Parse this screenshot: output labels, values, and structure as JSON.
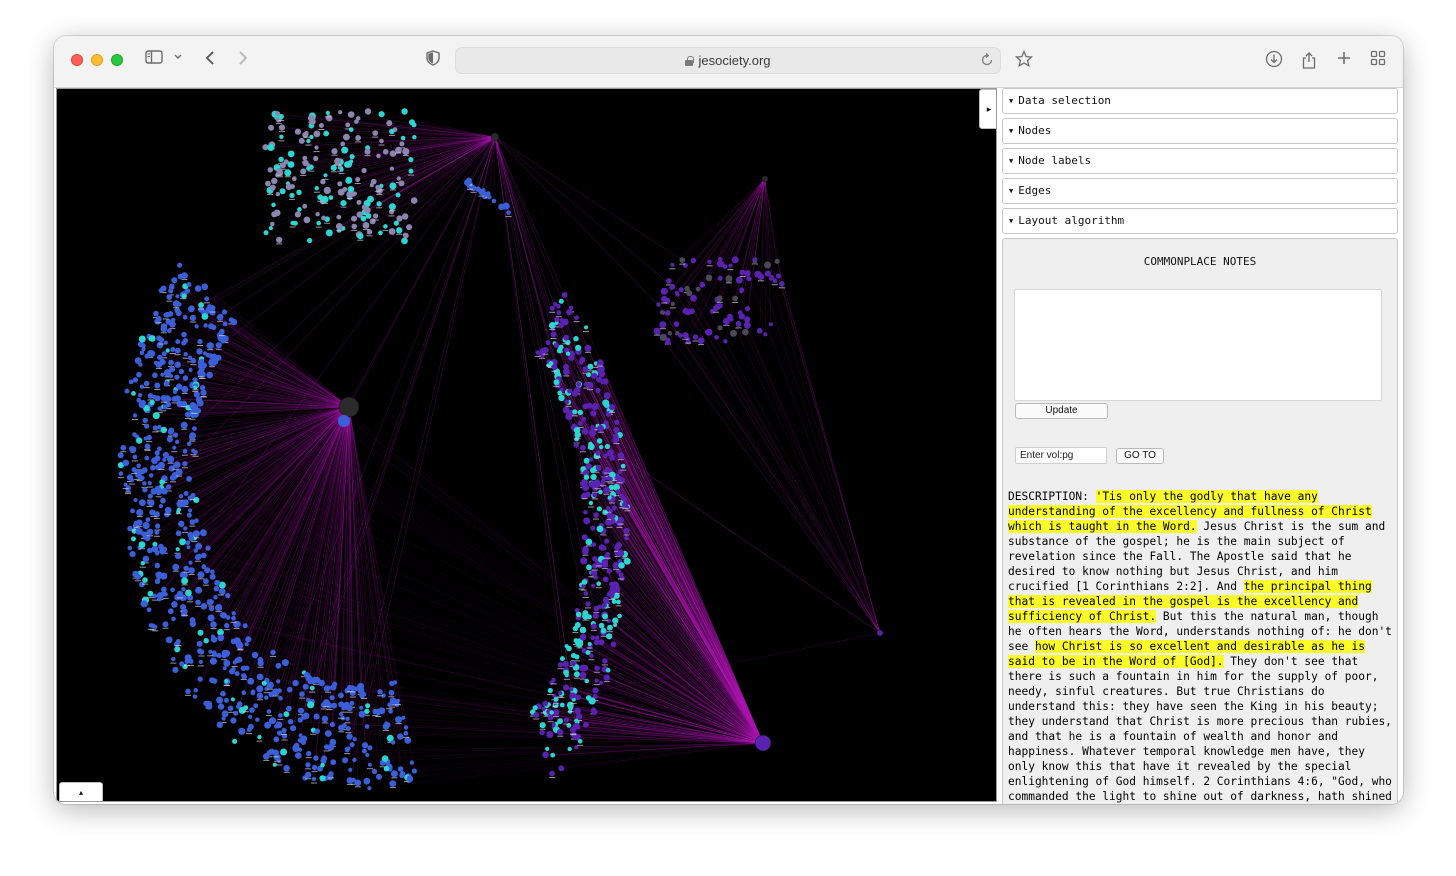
{
  "browser": {
    "url": "jesociety.org",
    "icons": [
      "sidebar-icon",
      "chevron-down-icon",
      "back-icon",
      "forward-icon",
      "shield-icon",
      "lock-icon",
      "reload-icon",
      "star-icon",
      "download-icon",
      "share-icon",
      "new-tab-icon",
      "tab-overview-icon"
    ]
  },
  "graph": {
    "toggle_right_label": "▸",
    "toggle_up_label": "▴",
    "colors": {
      "background": "#000000",
      "edge": "#b01cb8",
      "node_blue": "#3a5fd8",
      "node_cyan": "#2ad6d2",
      "node_purple": "#5a22b0",
      "hub": "#2a2a2a"
    }
  },
  "panel": {
    "sections": [
      {
        "label": "Data selection"
      },
      {
        "label": "Nodes"
      },
      {
        "label": "Node labels"
      },
      {
        "label": "Edges"
      },
      {
        "label": "Layout algorithm"
      }
    ],
    "notes": {
      "title": "COMMONPLACE NOTES",
      "update_label": "Update",
      "volpg_placeholder": "Enter vol:pg",
      "goto_label": "GO TO",
      "description_label": "DESCRIPTION:",
      "d1": "'Tis only the godly that have any understanding of the excellency and fullness of Christ which is taught in the Word.",
      "d2": " Jesus Christ is the sum and substance of the gospel; he is the main subject of revelation since the Fall. The Apostle said that he desired to know nothing but Jesus Christ, and him crucified [1 Corinthians 2:2]. And ",
      "d3": "the principal thing that is revealed in the gospel is the excellency and sufficiency of Christ.",
      "d4": " But this the natural man, though he often hears the Word, understands nothing of: he don't see ",
      "d5": "how Christ is so excellent and desirable as he is said to be in the Word of [God].",
      "d6": " They don't see that there is such a fountain in him for the supply of poor, needy, sinful creatures. But true Christians do understand this: they have seen the King in his beauty; they understand that Christ is more precious than rubies, and that he is a fountain of wealth and honor and happiness. Whatever temporal knowledge men have, they only know this that have it revealed by the special enlightening of God himself. 2 Corinthians 4:6, \"God, who commanded the light to shine out of darkness, hath shined"
    }
  }
}
